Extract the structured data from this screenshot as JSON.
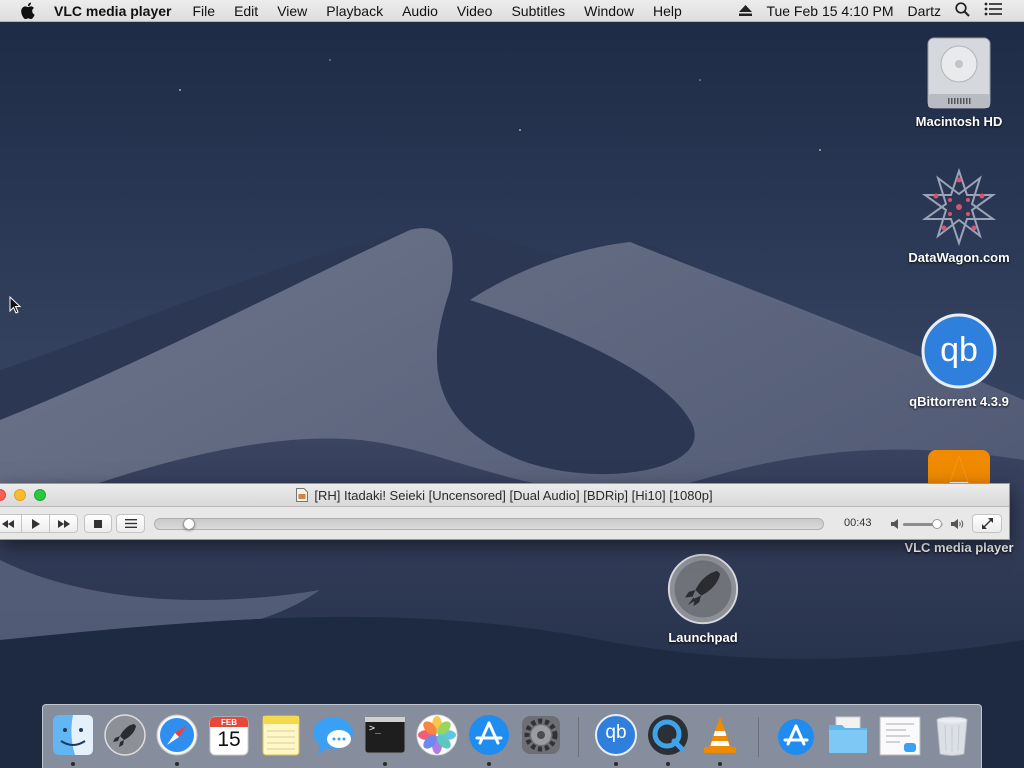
{
  "menubar": {
    "app_name": "VLC media player",
    "items": [
      "File",
      "Edit",
      "View",
      "Playback",
      "Audio",
      "Video",
      "Subtitles",
      "Window",
      "Help"
    ],
    "clock": "Tue Feb 15  4:10 PM",
    "user": "Dartz"
  },
  "desktop_icons": {
    "macintosh_hd": "Macintosh HD",
    "datawagon": "DataWagon.com",
    "qbittorrent": "qBittorrent 4.3.9",
    "vlc": "VLC media player",
    "launchpad": "Launchpad"
  },
  "vlc_window": {
    "title": "[RH] Itadaki! Seieki [Uncensored] [Dual Audio] [BDRip] [Hi10] [1080p]",
    "elapsed": "00:43",
    "seek_position": 0.04,
    "volume_level": 0.85
  },
  "dock": {
    "calendar_month": "FEB",
    "calendar_day": "15",
    "qbittorrent_glyph": "qb",
    "terminal_glyph": ">_"
  },
  "colors": {
    "accent_blue": "#2f7fdc",
    "vlc_orange": "#f08a00"
  }
}
